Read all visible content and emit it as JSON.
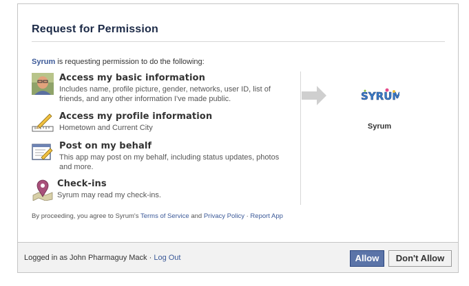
{
  "dialog": {
    "title": "Request for Permission",
    "app_name": "Syrum",
    "intro_suffix": " is requesting permission to do the following:"
  },
  "permissions": [
    {
      "title": "Access my basic information",
      "description": "Includes name, profile picture, gender, networks, user ID, list of friends, and any other information I've made public.",
      "icon": "user-photo-icon"
    },
    {
      "title": "Access my profile information",
      "description": "Hometown and Current City",
      "icon": "pencil-ruler-icon"
    },
    {
      "title": "Post on my behalf",
      "description": "This app may post on my behalf, including status updates, photos and more.",
      "icon": "edit-note-icon"
    },
    {
      "title": "Check-ins",
      "description": "Syrum may read my check-ins.",
      "icon": "map-pin-icon"
    }
  ],
  "app": {
    "logo_text": "SYRUM",
    "name": "Syrum"
  },
  "terms": {
    "prefix": "By proceeding, you agree to Syrum's ",
    "terms_link": "Terms of Service",
    "and": " and ",
    "privacy_link": "Privacy Policy",
    "sep": " · ",
    "report_link": "Report App"
  },
  "footer": {
    "logged_in_as": "Logged in as John Pharmaguy Mack",
    "sep": " · ",
    "logout_link": "Log Out",
    "allow_label": "Allow",
    "deny_label": "Don't Allow"
  },
  "colors": {
    "link": "#3b5998",
    "title": "#1c2a47",
    "allow_bg": "#5b74a8"
  }
}
